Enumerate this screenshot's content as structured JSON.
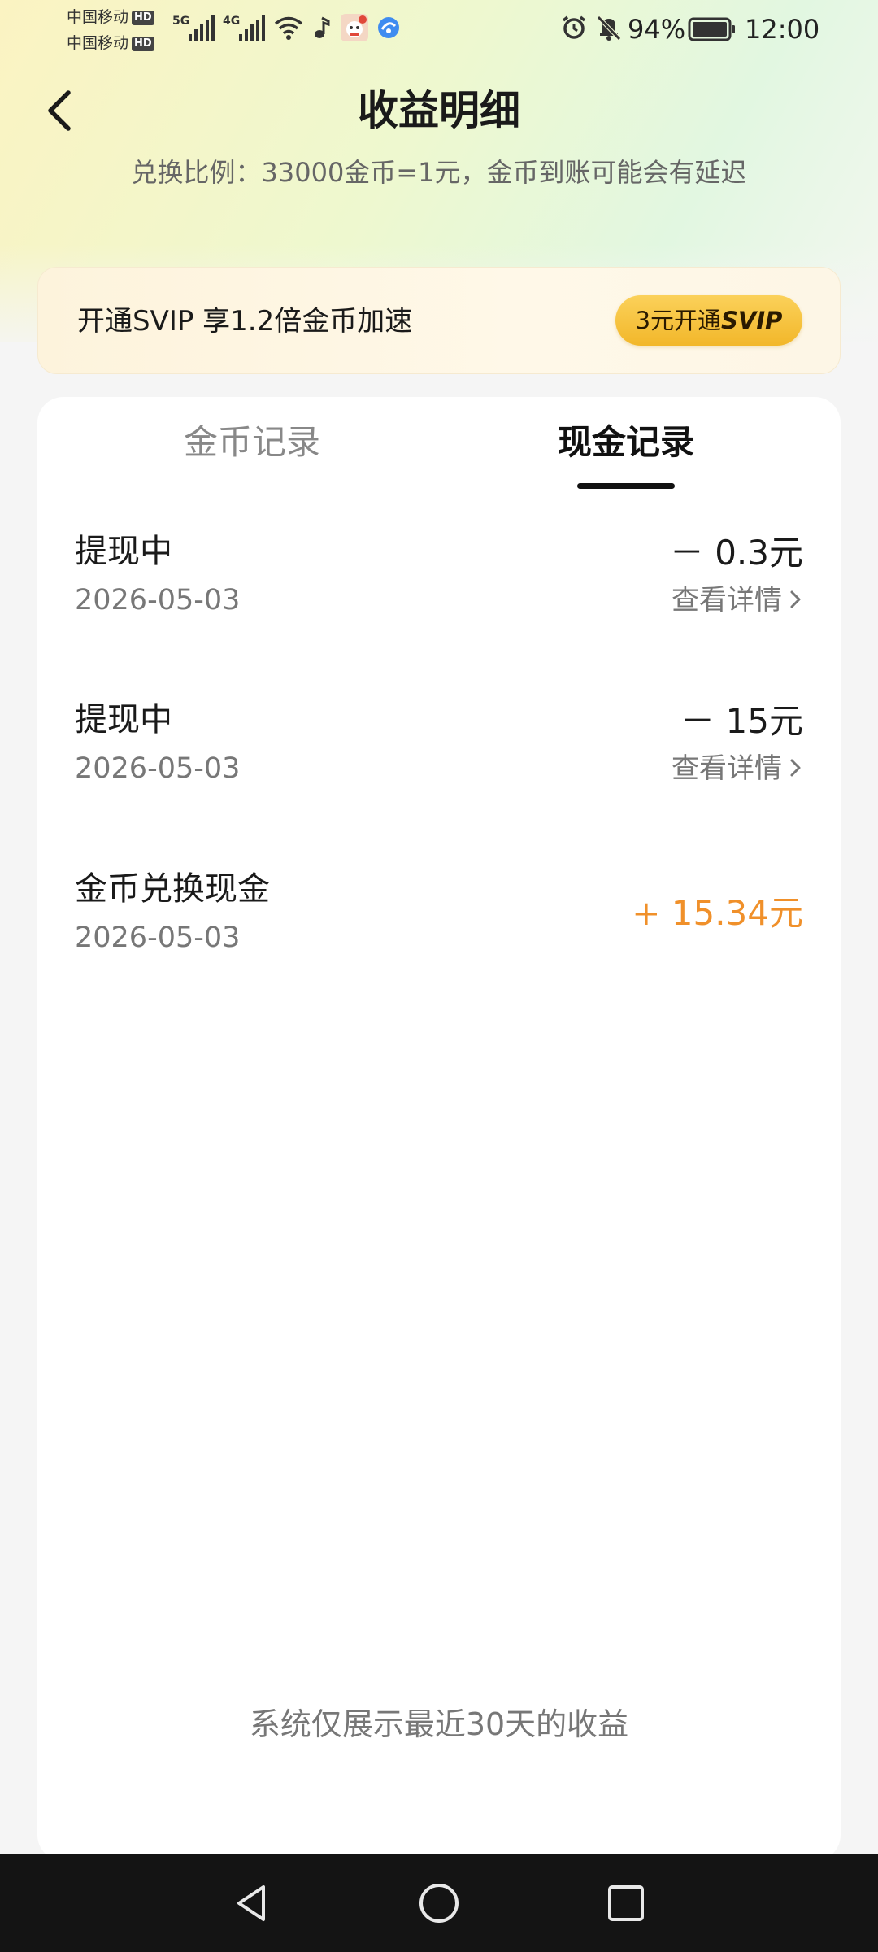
{
  "status_bar": {
    "carrier_1": "中国移动",
    "carrier_2": "中国移动",
    "hd_badge": "HD",
    "network_1": "5G",
    "network_2": "4G",
    "battery": "94%",
    "time": "12:00"
  },
  "header": {
    "title": "收益明细",
    "subtitle": "兑换比例：33000金币=1元，金币到账可能会有延迟",
    "back_icon": "chevron-left-icon"
  },
  "svip_banner": {
    "text": "开通SVIP 享1.2倍金币加速",
    "button_prefix": "3元开通",
    "button_strong": "SVIP"
  },
  "tabs": [
    {
      "label": "金币记录",
      "active": false
    },
    {
      "label": "现金记录",
      "active": true
    }
  ],
  "records": [
    {
      "title": "提现中",
      "date": "2026-05-03",
      "amount": "－ 0.3元",
      "detail": "查看详情"
    },
    {
      "title": "提现中",
      "date": "2026-05-03",
      "amount": "－ 15元",
      "detail": "查看详情"
    },
    {
      "title": "金币兑换现金",
      "date": "2026-05-03",
      "amount": "+ 15.34元"
    }
  ],
  "footer_note": "系统仅展示最近30天的收益",
  "colors": {
    "positive_amount": "#f0902a",
    "svip_button": "#f5c13c",
    "active_tab": "#111111",
    "inactive_tab": "#888888"
  },
  "nav_icons": [
    "back-triangle-icon",
    "home-circle-icon",
    "recents-square-icon"
  ]
}
